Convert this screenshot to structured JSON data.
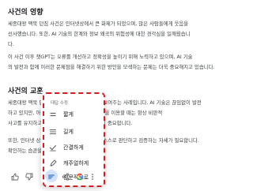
{
  "sections": [
    {
      "heading": "사건의 영향",
      "lines": [
        "세종대왕 맥북 던짐 사건은 인터넷상에서 큰 화제가 되었으며, 많은 사람들에게 웃음을",
        "선사했습니다. 또한, AI 기술의 한계와 정보 왜곡의 위험성에 대한 경각심을 일깨웠습니",
        "다."
      ]
    },
    {
      "heading": "",
      "lines": [
        "이 사건 이후 챗GPT는 오류를 개선하고 정확성을 높이기 위해 노력하고 있으며, AI 기술",
        "의 발전과 함께 이러한 문제점을 해결하기 위한 방안을 모색하는 문제는 더욱 중요해지고 있습니다."
      ]
    },
    {
      "heading": "사건의 교훈",
      "lines": [
        "세종대왕 맥북 던짐 사건은 AI 기술의 한계를 보여주는 사례입니다. AI 기술은 끊임없이 발전",
        "하고 있지만, 아직 완벽하지 않습니다. AI 기술을 이용할 때는 항상 비판적",
        "사고를 유지하고, 정보의 진위를 확인하는 것이 중요합니다."
      ]
    },
    {
      "heading": "",
      "lines": [
        "또한, 인터넷 상의 정보를 무조건 믿기보다는 스스로 판단하고 검증하는 자세가 필요합니다.",
        "확인하는 습관을 길러야 합니다."
      ]
    }
  ],
  "menu": {
    "title": "대답 수정",
    "items": [
      {
        "label": "짧게",
        "icon": "short-lines-icon"
      },
      {
        "label": "길게",
        "icon": "long-lines-icon"
      },
      {
        "label": "간결하게",
        "icon": "checkmark-icon"
      },
      {
        "label": "캐주얼하게",
        "icon": "casual-icon"
      },
      {
        "label": "전문적으로",
        "icon": "briefcase-icon"
      }
    ]
  },
  "actions": [
    {
      "name": "thumbs-up-icon"
    },
    {
      "name": "thumbs-down-icon"
    },
    {
      "name": "modify-response-icon"
    },
    {
      "name": "share-icon"
    },
    {
      "name": "google-icon"
    },
    {
      "name": "more-options-icon"
    }
  ],
  "colors": {
    "highlight": "#d81b23",
    "icon": "#5f6368",
    "google_blue": "#4285f4",
    "google_red": "#ea4335",
    "google_yellow": "#fbbc05",
    "google_green": "#34a853",
    "active_chip": "#d3e3fd"
  }
}
